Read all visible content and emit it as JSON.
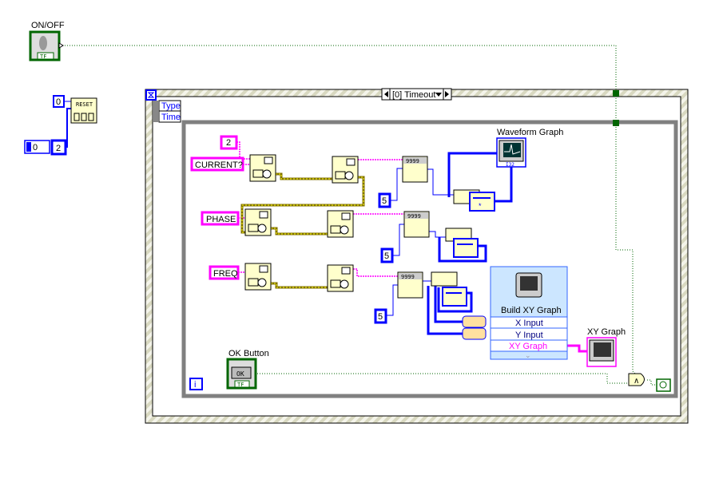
{
  "controls": {
    "on_off_label": "ON/OFF",
    "ok_button_label": "OK Button",
    "ok_button_text": "OK",
    "bool_tag": "TF",
    "numeric_value": "0",
    "const_zero": "0",
    "const_two": "2",
    "reset_label": "RESET"
  },
  "event_structure": {
    "selector": "[0] Timeout",
    "event_data": [
      "Type",
      "Time"
    ]
  },
  "while_loop": {
    "iteration": "i"
  },
  "commands": {
    "address": "2",
    "current": "CURRENT?",
    "phase": "PHASE",
    "freq": "FREQ",
    "count_constants": [
      "5",
      "5",
      "5"
    ],
    "format_text": "9999"
  },
  "indicators": {
    "waveform_graph": "Waveform Graph",
    "waveform_type": "I32",
    "xy_graph": "XY Graph"
  },
  "express_vi": {
    "title": "Build XY Graph",
    "inputs": [
      "X Input",
      "Y Input"
    ],
    "output": "XY Graph"
  },
  "colors": {
    "boolean_wire": "#006600",
    "numeric_wire": "#0000ff",
    "string_wire": "#ff00ff",
    "error_wire": "#b8a800",
    "node_fill": "#ffffcc",
    "express_fill": "#cce6ff",
    "loop_border": "#808080"
  }
}
